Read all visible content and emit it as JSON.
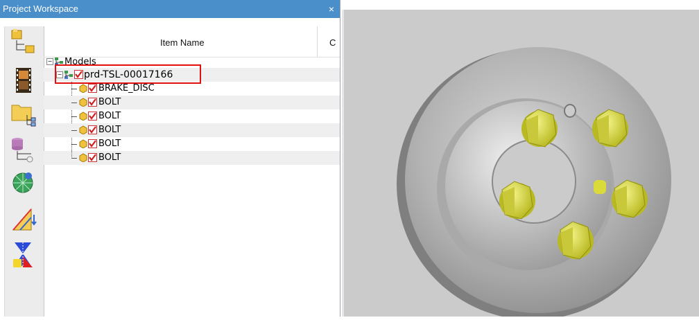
{
  "panel": {
    "title": "Project Workspace",
    "close_glyph": "×"
  },
  "toolbar": {
    "buttons": [
      {
        "icon": "models-tree-icon"
      },
      {
        "icon": "film-animation-icon"
      },
      {
        "icon": "folder-tree-icon"
      },
      {
        "icon": "database-tree-icon"
      },
      {
        "icon": "mesh-globe-icon"
      },
      {
        "icon": "measure-triangle-icon"
      },
      {
        "icon": "hourglass-symmetry-icon"
      }
    ]
  },
  "tree": {
    "columns": [
      "Item Name",
      "C"
    ],
    "root": {
      "label": "Models"
    },
    "product": {
      "label": "prd-TSL-00017166",
      "checked": true,
      "highlighted": true
    },
    "parts": [
      {
        "label": "BRAKE_DISC",
        "checked": true
      },
      {
        "label": "BOLT",
        "checked": true
      },
      {
        "label": "BOLT",
        "checked": true
      },
      {
        "label": "BOLT",
        "checked": true
      },
      {
        "label": "BOLT",
        "checked": true
      },
      {
        "label": "BOLT",
        "checked": true
      }
    ]
  },
  "viewport": {
    "model": "brake-disc-with-bolts",
    "colors": {
      "background": "#cbcbcb",
      "disc": "#b5b5b5",
      "bolt": "#e3e34a",
      "highlight": "#e01010"
    }
  }
}
